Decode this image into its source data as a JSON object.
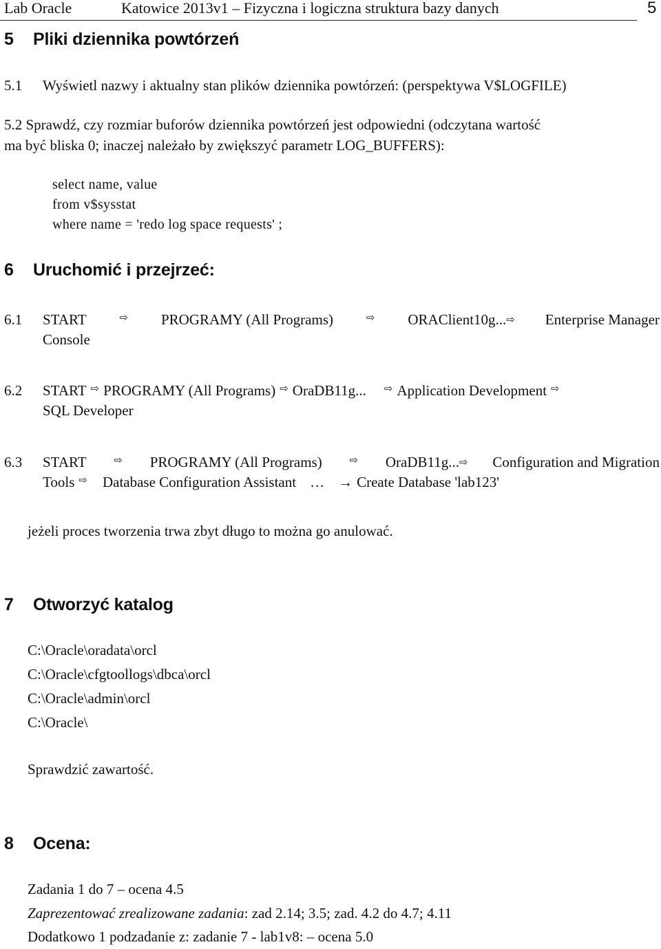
{
  "header": {
    "left": "Lab  Oracle",
    "title": "Katowice 2013v1 –  Fizyczna i logiczna struktura bazy danych",
    "page_number": "5"
  },
  "sections": {
    "s5": {
      "number": "5",
      "title": "Pliki dziennika powtórzeń",
      "s5_1": {
        "number": "5.1",
        "text": "Wyświetl nazwy i aktualny stan plików dziennika powtórzeń: (perspektywa V$LOGFILE)"
      },
      "s5_2": {
        "line1": "5.2 Sprawdź, czy rozmiar buforów dziennika powtórzeń jest odpowiedni (odczytana wartość",
        "line2": "ma być bliska 0; inaczej należało by zwiększyć parametr LOG_BUFFERS):",
        "code": [
          "select name, value",
          "from v$sysstat",
          "where name = 'redo log space requests' ;"
        ]
      }
    },
    "s6": {
      "number": "6",
      "title": "Uruchomić i przejrzeć:",
      "arrow_icon": "⇨",
      "items": [
        {
          "number": "6.1",
          "path": [
            "START",
            "PROGRAMY (All Programs)",
            "ORAClient10g...",
            "Enterprise Manager"
          ],
          "continuation": "Console"
        },
        {
          "number": "6.2",
          "path": [
            "START",
            "PROGRAMY (All Programs)",
            "OraDB11g...",
            "Application Development"
          ],
          "continuation": "SQL Developer"
        },
        {
          "number": "6.3",
          "path": [
            "START",
            "PROGRAMY (All Programs)",
            "OraDB11g...",
            "Configuration and Migration"
          ],
          "continuation_path": [
            "Tools",
            "Database Configuration Assistant"
          ],
          "ellipsis": "…",
          "right_arrow": "→",
          "final_step": "Create Database 'lab123'"
        }
      ],
      "note": "jeżeli proces tworzenia trwa zbyt długo to można go anulować."
    },
    "s7": {
      "number": "7",
      "title": "Otworzyć katalog",
      "paths": [
        "C:\\Oracle\\oradata\\orcl",
        "C:\\Oracle\\cfgtoollogs\\dbca\\orcl",
        "C:\\Oracle\\admin\\orcl",
        "C:\\Oracle\\"
      ],
      "note": "Sprawdzić zawartość."
    },
    "s8": {
      "number": "8",
      "title": "Ocena:",
      "line1": "Zadania 1 do 7 – ocena 4.5",
      "line2_italic": "Zaprezentować zrealizowane zadania",
      "line2_rest": ": zad 2.14; 3.5;  zad. 4.2 do 4.7;  4.11",
      "line3": "Dodatkowo 1 podzadanie z: zadanie 7 - lab1v8: – ocena 5.0"
    }
  }
}
